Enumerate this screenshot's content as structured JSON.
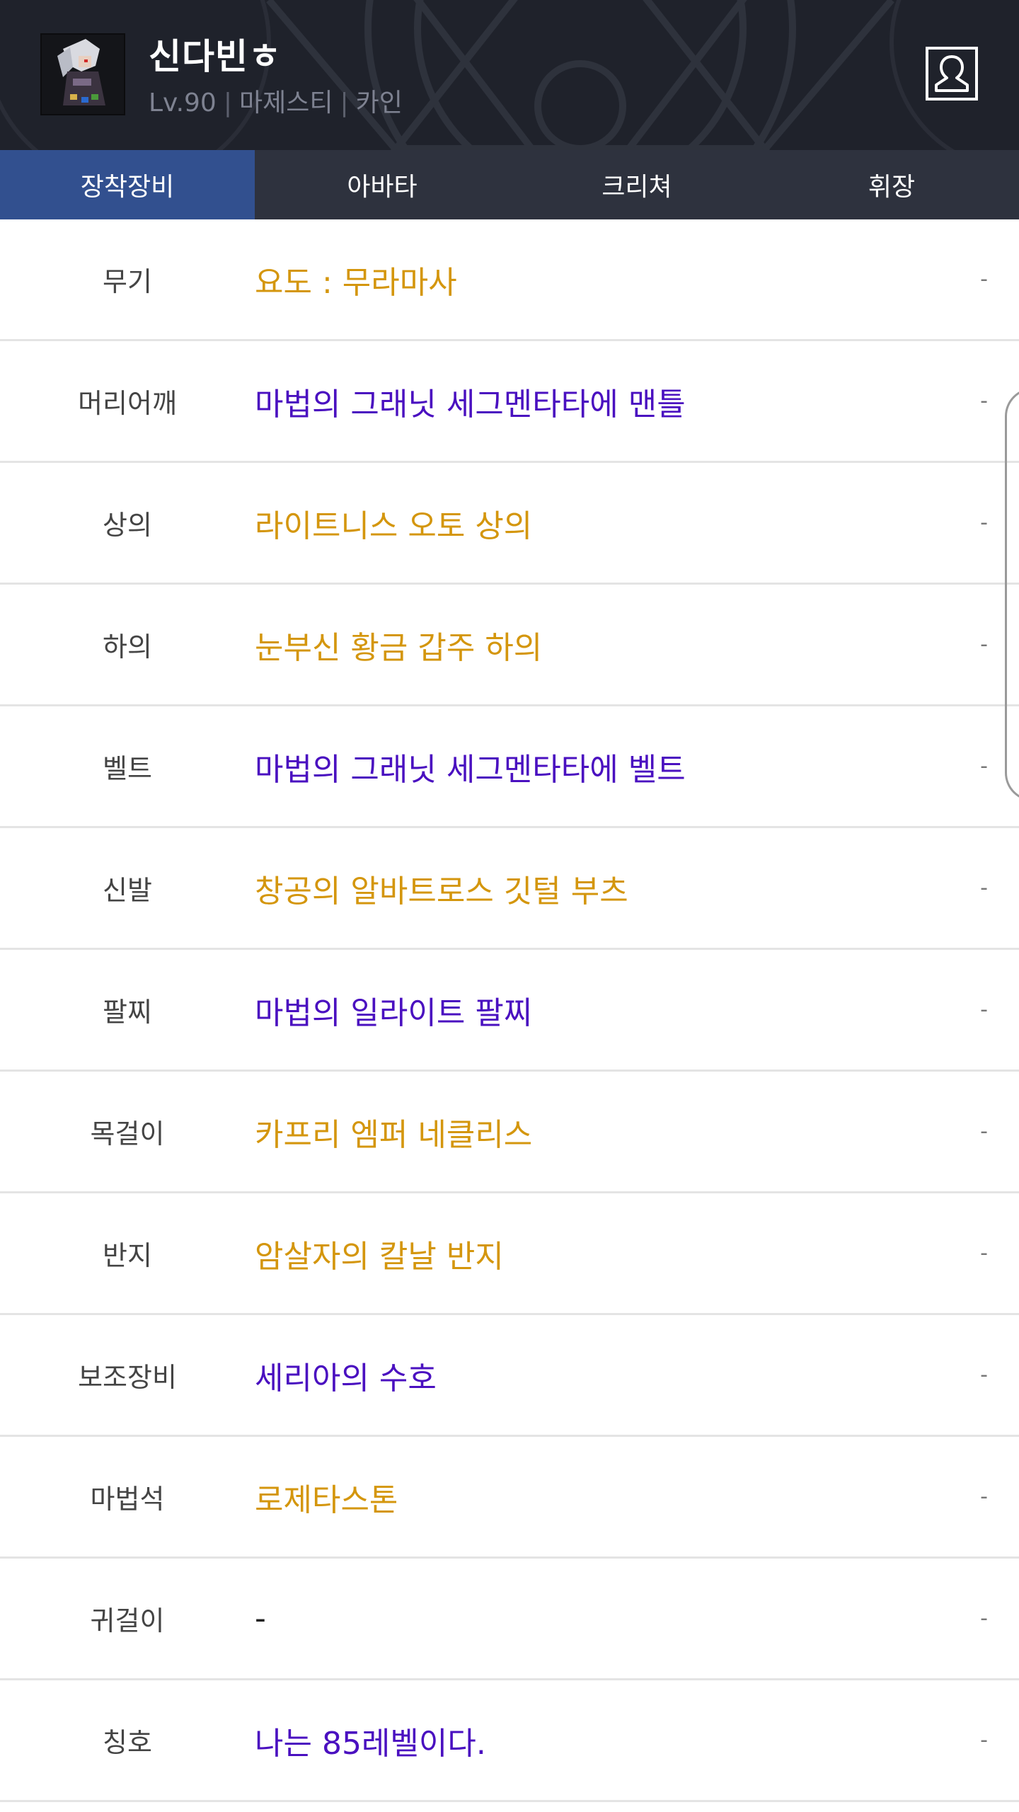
{
  "header": {
    "name": "신다빈ㅎ",
    "level": "Lv.90",
    "job": "마제스티",
    "server": "카인"
  },
  "tabs": [
    {
      "label": "장착장비",
      "active": true
    },
    {
      "label": "아바타",
      "active": false
    },
    {
      "label": "크리쳐",
      "active": false
    },
    {
      "label": "휘장",
      "active": false
    }
  ],
  "colors": {
    "unique": "#d4960d",
    "rare": "#4a10c0",
    "tab_active": "#32508f",
    "header_bg": "#1f222b"
  },
  "equipment": [
    {
      "slot": "무기",
      "item": "요도 : 무라마사",
      "rarity": "unique",
      "extra": "-"
    },
    {
      "slot": "머리어깨",
      "item": "마법의 그래닛 세그멘타타에 맨틀",
      "rarity": "rare",
      "extra": "-"
    },
    {
      "slot": "상의",
      "item": "라이트니스 오토 상의",
      "rarity": "unique",
      "extra": "-"
    },
    {
      "slot": "하의",
      "item": "눈부신 황금 갑주 하의",
      "rarity": "unique",
      "extra": "-"
    },
    {
      "slot": "벨트",
      "item": "마법의 그래닛 세그멘타타에 벨트",
      "rarity": "rare",
      "extra": "-"
    },
    {
      "slot": "신발",
      "item": "창공의 알바트로스 깃털 부츠",
      "rarity": "unique",
      "extra": "-"
    },
    {
      "slot": "팔찌",
      "item": "마법의 일라이트 팔찌",
      "rarity": "rare",
      "extra": "-"
    },
    {
      "slot": "목걸이",
      "item": "카프리 엠퍼 네클리스",
      "rarity": "unique",
      "extra": "-"
    },
    {
      "slot": "반지",
      "item": "암살자의 칼날 반지",
      "rarity": "unique",
      "extra": "-"
    },
    {
      "slot": "보조장비",
      "item": "세리아의 수호",
      "rarity": "rare",
      "extra": "-"
    },
    {
      "slot": "마법석",
      "item": "로제타스톤",
      "rarity": "unique",
      "extra": "-"
    },
    {
      "slot": "귀걸이",
      "item": "-",
      "rarity": "none",
      "extra": "-"
    },
    {
      "slot": "칭호",
      "item": "나는 85레벨이다.",
      "rarity": "rare",
      "extra": "-"
    }
  ]
}
